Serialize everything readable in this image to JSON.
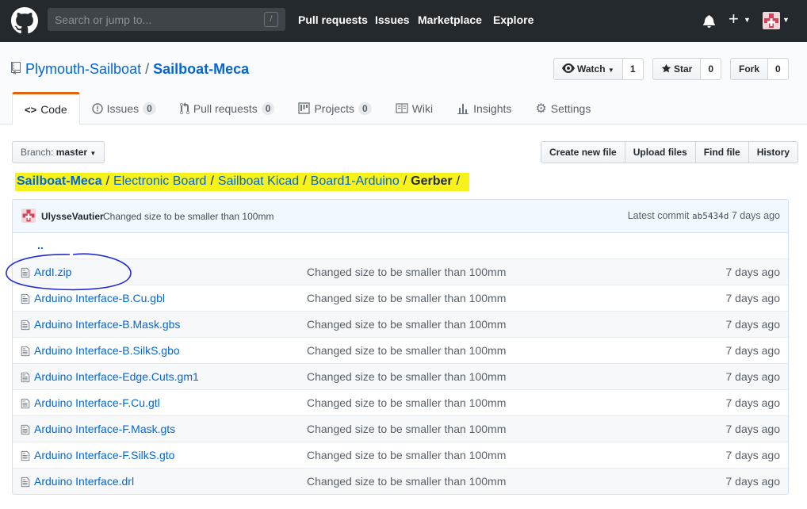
{
  "header": {
    "search_placeholder": "Search or jump to...",
    "search_key": "/",
    "nav": [
      "Pull requests",
      "Issues",
      "Marketplace",
      "Explore"
    ]
  },
  "repo": {
    "owner": "Plymouth-Sailboat",
    "separator": "/",
    "name": "Sailboat-Meca",
    "watch_label": "Watch",
    "watch_count": "1",
    "star_label": "Star",
    "star_count": "0",
    "fork_label": "Fork",
    "fork_count": "0"
  },
  "tabs": [
    {
      "label": "Code",
      "count": null
    },
    {
      "label": "Issues",
      "count": "0"
    },
    {
      "label": "Pull requests",
      "count": "0"
    },
    {
      "label": "Projects",
      "count": "0"
    },
    {
      "label": "Wiki",
      "count": null
    },
    {
      "label": "Insights",
      "count": null
    },
    {
      "label": "Settings",
      "count": null
    }
  ],
  "branch": {
    "prefix": "Branch:",
    "name": "master"
  },
  "file_buttons": [
    "Create new file",
    "Upload files",
    "Find file",
    "History"
  ],
  "breadcrumb": {
    "root": "Sailboat-Meca",
    "parts": [
      "Electronic Board",
      "Sailboat Kicad",
      "Board1-Arduino"
    ],
    "current": "Gerber",
    "sep": "/"
  },
  "commit": {
    "author": "UlysseVautier",
    "message": "Changed size to be smaller than 100mm",
    "latest_label": "Latest commit",
    "sha": "ab5434d",
    "age": "7 days ago"
  },
  "parent_dir": "..",
  "files": [
    {
      "name": "ArdI.zip",
      "message": "Changed size to be smaller than 100mm",
      "age": "7 days ago"
    },
    {
      "name": "Arduino Interface-B.Cu.gbl",
      "message": "Changed size to be smaller than 100mm",
      "age": "7 days ago"
    },
    {
      "name": "Arduino Interface-B.Mask.gbs",
      "message": "Changed size to be smaller than 100mm",
      "age": "7 days ago"
    },
    {
      "name": "Arduino Interface-B.SilkS.gbo",
      "message": "Changed size to be smaller than 100mm",
      "age": "7 days ago"
    },
    {
      "name": "Arduino Interface-Edge.Cuts.gm1",
      "message": "Changed size to be smaller than 100mm",
      "age": "7 days ago"
    },
    {
      "name": "Arduino Interface-F.Cu.gtl",
      "message": "Changed size to be smaller than 100mm",
      "age": "7 days ago"
    },
    {
      "name": "Arduino Interface-F.Mask.gts",
      "message": "Changed size to be smaller than 100mm",
      "age": "7 days ago"
    },
    {
      "name": "Arduino Interface-F.SilkS.gto",
      "message": "Changed size to be smaller than 100mm",
      "age": "7 days ago"
    },
    {
      "name": "Arduino Interface.drl",
      "message": "Changed size to be smaller than 100mm",
      "age": "7 days ago"
    }
  ],
  "colors": {
    "header_bg": "#24292e",
    "link": "#0366d6",
    "highlight": "#f7f21a",
    "tab_accent": "#e36209",
    "annotation": "#1f2bd6"
  },
  "icons": [
    "github-logo-icon",
    "bell-icon",
    "plus-icon",
    "avatar-icon",
    "repo-icon",
    "eye-icon",
    "star-icon",
    "fork-icon",
    "code-icon",
    "issue-icon",
    "pull-request-icon",
    "project-icon",
    "wiki-icon",
    "graph-icon",
    "gear-icon",
    "file-icon"
  ]
}
